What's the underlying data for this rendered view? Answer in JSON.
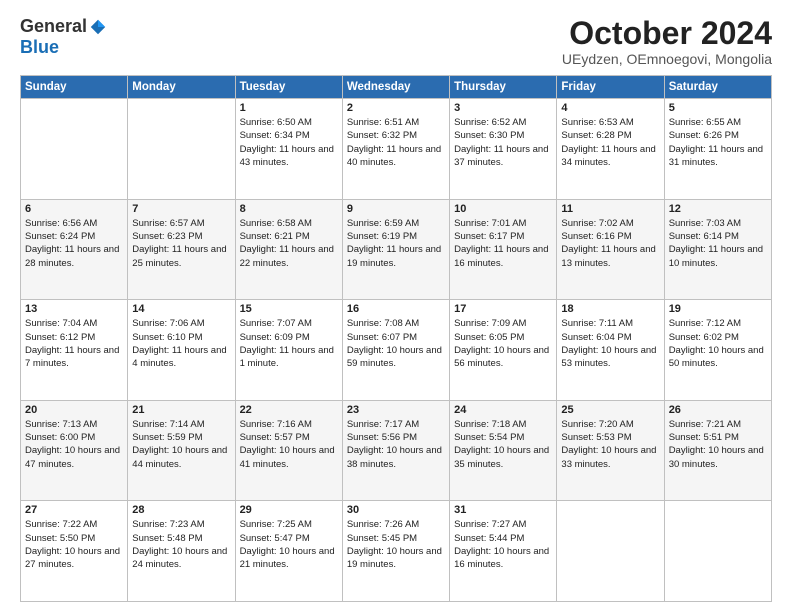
{
  "header": {
    "logo_general": "General",
    "logo_blue": "Blue",
    "title": "October 2024",
    "location": "UEydzen, OEmnoegovi, Mongolia"
  },
  "days_of_week": [
    "Sunday",
    "Monday",
    "Tuesday",
    "Wednesday",
    "Thursday",
    "Friday",
    "Saturday"
  ],
  "weeks": [
    [
      {
        "day": "",
        "info": ""
      },
      {
        "day": "",
        "info": ""
      },
      {
        "day": "1",
        "info": "Sunrise: 6:50 AM\nSunset: 6:34 PM\nDaylight: 11 hours and 43 minutes."
      },
      {
        "day": "2",
        "info": "Sunrise: 6:51 AM\nSunset: 6:32 PM\nDaylight: 11 hours and 40 minutes."
      },
      {
        "day": "3",
        "info": "Sunrise: 6:52 AM\nSunset: 6:30 PM\nDaylight: 11 hours and 37 minutes."
      },
      {
        "day": "4",
        "info": "Sunrise: 6:53 AM\nSunset: 6:28 PM\nDaylight: 11 hours and 34 minutes."
      },
      {
        "day": "5",
        "info": "Sunrise: 6:55 AM\nSunset: 6:26 PM\nDaylight: 11 hours and 31 minutes."
      }
    ],
    [
      {
        "day": "6",
        "info": "Sunrise: 6:56 AM\nSunset: 6:24 PM\nDaylight: 11 hours and 28 minutes."
      },
      {
        "day": "7",
        "info": "Sunrise: 6:57 AM\nSunset: 6:23 PM\nDaylight: 11 hours and 25 minutes."
      },
      {
        "day": "8",
        "info": "Sunrise: 6:58 AM\nSunset: 6:21 PM\nDaylight: 11 hours and 22 minutes."
      },
      {
        "day": "9",
        "info": "Sunrise: 6:59 AM\nSunset: 6:19 PM\nDaylight: 11 hours and 19 minutes."
      },
      {
        "day": "10",
        "info": "Sunrise: 7:01 AM\nSunset: 6:17 PM\nDaylight: 11 hours and 16 minutes."
      },
      {
        "day": "11",
        "info": "Sunrise: 7:02 AM\nSunset: 6:16 PM\nDaylight: 11 hours and 13 minutes."
      },
      {
        "day": "12",
        "info": "Sunrise: 7:03 AM\nSunset: 6:14 PM\nDaylight: 11 hours and 10 minutes."
      }
    ],
    [
      {
        "day": "13",
        "info": "Sunrise: 7:04 AM\nSunset: 6:12 PM\nDaylight: 11 hours and 7 minutes."
      },
      {
        "day": "14",
        "info": "Sunrise: 7:06 AM\nSunset: 6:10 PM\nDaylight: 11 hours and 4 minutes."
      },
      {
        "day": "15",
        "info": "Sunrise: 7:07 AM\nSunset: 6:09 PM\nDaylight: 11 hours and 1 minute."
      },
      {
        "day": "16",
        "info": "Sunrise: 7:08 AM\nSunset: 6:07 PM\nDaylight: 10 hours and 59 minutes."
      },
      {
        "day": "17",
        "info": "Sunrise: 7:09 AM\nSunset: 6:05 PM\nDaylight: 10 hours and 56 minutes."
      },
      {
        "day": "18",
        "info": "Sunrise: 7:11 AM\nSunset: 6:04 PM\nDaylight: 10 hours and 53 minutes."
      },
      {
        "day": "19",
        "info": "Sunrise: 7:12 AM\nSunset: 6:02 PM\nDaylight: 10 hours and 50 minutes."
      }
    ],
    [
      {
        "day": "20",
        "info": "Sunrise: 7:13 AM\nSunset: 6:00 PM\nDaylight: 10 hours and 47 minutes."
      },
      {
        "day": "21",
        "info": "Sunrise: 7:14 AM\nSunset: 5:59 PM\nDaylight: 10 hours and 44 minutes."
      },
      {
        "day": "22",
        "info": "Sunrise: 7:16 AM\nSunset: 5:57 PM\nDaylight: 10 hours and 41 minutes."
      },
      {
        "day": "23",
        "info": "Sunrise: 7:17 AM\nSunset: 5:56 PM\nDaylight: 10 hours and 38 minutes."
      },
      {
        "day": "24",
        "info": "Sunrise: 7:18 AM\nSunset: 5:54 PM\nDaylight: 10 hours and 35 minutes."
      },
      {
        "day": "25",
        "info": "Sunrise: 7:20 AM\nSunset: 5:53 PM\nDaylight: 10 hours and 33 minutes."
      },
      {
        "day": "26",
        "info": "Sunrise: 7:21 AM\nSunset: 5:51 PM\nDaylight: 10 hours and 30 minutes."
      }
    ],
    [
      {
        "day": "27",
        "info": "Sunrise: 7:22 AM\nSunset: 5:50 PM\nDaylight: 10 hours and 27 minutes."
      },
      {
        "day": "28",
        "info": "Sunrise: 7:23 AM\nSunset: 5:48 PM\nDaylight: 10 hours and 24 minutes."
      },
      {
        "day": "29",
        "info": "Sunrise: 7:25 AM\nSunset: 5:47 PM\nDaylight: 10 hours and 21 minutes."
      },
      {
        "day": "30",
        "info": "Sunrise: 7:26 AM\nSunset: 5:45 PM\nDaylight: 10 hours and 19 minutes."
      },
      {
        "day": "31",
        "info": "Sunrise: 7:27 AM\nSunset: 5:44 PM\nDaylight: 10 hours and 16 minutes."
      },
      {
        "day": "",
        "info": ""
      },
      {
        "day": "",
        "info": ""
      }
    ]
  ]
}
